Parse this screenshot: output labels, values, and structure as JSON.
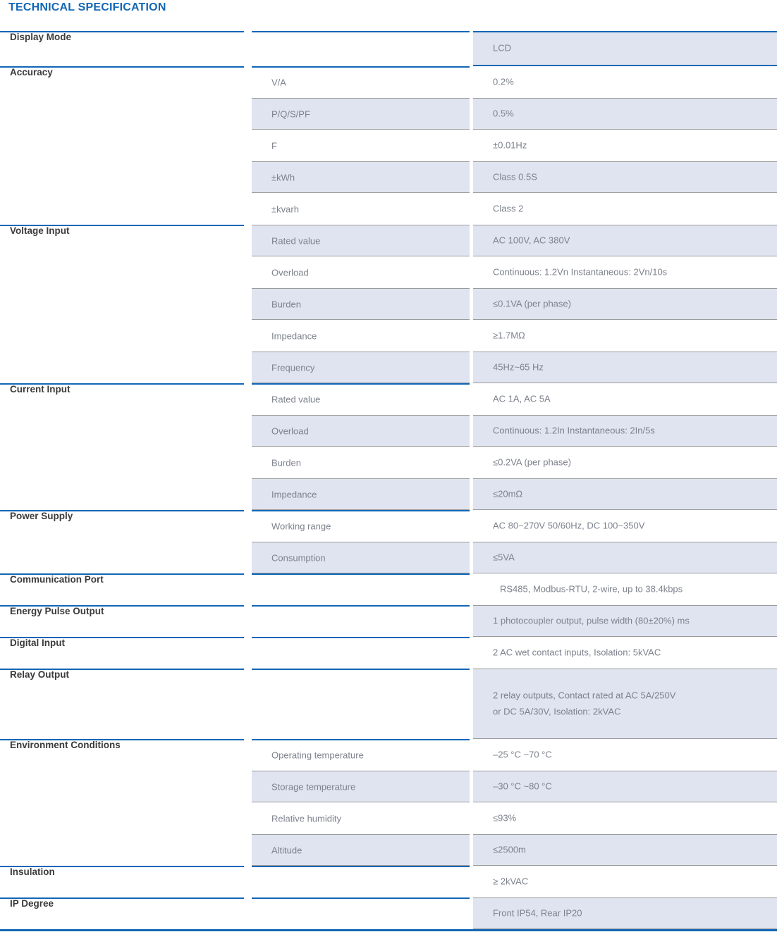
{
  "title": "TECHNICAL SPECIFICATION",
  "colors": {
    "accent_blue": "#1267B5",
    "row_shade": "#DFE4F0",
    "rule_gray": "#9A9A9A",
    "label_text": "#3B3B3B",
    "value_text": "#7D828C"
  },
  "groups": [
    {
      "label": "Display Mode",
      "rows": [
        {
          "param": "",
          "value": "LCD",
          "shaded": true
        }
      ]
    },
    {
      "label": "Accuracy",
      "rows": [
        {
          "param": "V/A",
          "value": "0.2%",
          "shaded": false
        },
        {
          "param": "P/Q/S/PF",
          "value": "0.5%",
          "shaded": true
        },
        {
          "param": "F",
          "value": "±0.01Hz",
          "shaded": false
        },
        {
          "param": "±kWh",
          "value": "Class 0.5S",
          "shaded": true
        },
        {
          "param": "±kvarh",
          "value": "Class 2",
          "shaded": false
        }
      ]
    },
    {
      "label": "Voltage Input",
      "rows": [
        {
          "param": "Rated value",
          "value": "AC 100V, AC 380V",
          "shaded": true
        },
        {
          "param": "Overload",
          "value": "Continuous: 1.2Vn  Instantaneous: 2Vn/10s",
          "shaded": false
        },
        {
          "param": "Burden",
          "value": "≤0.1VA (per phase)",
          "shaded": true
        },
        {
          "param": "Impedance",
          "value": "≥1.7MΩ",
          "shaded": false
        },
        {
          "param": "Frequency",
          "value": "45Hz~65 Hz",
          "shaded": true
        }
      ]
    },
    {
      "label": "Current Input",
      "rows": [
        {
          "param": "Rated value",
          "value": "AC 1A, AC 5A",
          "shaded": false
        },
        {
          "param": "Overload",
          "value": "Continuous: 1.2In  Instantaneous: 2In/5s",
          "shaded": true
        },
        {
          "param": "Burden",
          "value": "≤0.2VA (per phase)",
          "shaded": false
        },
        {
          "param": "Impedance",
          "value": "≤20mΩ",
          "shaded": true
        }
      ]
    },
    {
      "label": "Power Supply",
      "rows": [
        {
          "param": "Working range",
          "value": "AC 80~270V 50/60Hz, DC 100~350V",
          "shaded": false
        },
        {
          "param": "Consumption",
          "value": "≤5VA",
          "shaded": true
        }
      ]
    },
    {
      "label": "Communication Port",
      "rows": [
        {
          "param": "",
          "value": "RS485, Modbus-RTU, 2-wire, up to 38.4kbps",
          "shaded": false,
          "wide_indent": true
        }
      ]
    },
    {
      "label": "Energy Pulse Output",
      "rows": [
        {
          "param": "",
          "value": "1 photocoupler output, pulse width (80±20%) ms",
          "shaded": true
        }
      ]
    },
    {
      "label": "Digital Input",
      "rows": [
        {
          "param": "",
          "value": "2 AC wet contact inputs, Isolation: 5kVAC",
          "shaded": false
        }
      ]
    },
    {
      "label": "Relay Output",
      "rows": [
        {
          "param": "",
          "value": "2 relay outputs, Contact rated at AC 5A/250V\nor DC 5A/30V, Isolation: 2kVAC",
          "shaded": true,
          "tall": true
        }
      ]
    },
    {
      "label": "Environment Conditions",
      "rows": [
        {
          "param": "Operating temperature",
          "value": "–25 °C ~70 °C",
          "shaded": false
        },
        {
          "param": "Storage temperature",
          "value": "–30 °C ~80 °C",
          "shaded": true
        },
        {
          "param": "Relative humidity",
          "value": "≤93%",
          "shaded": false
        },
        {
          "param": "Altitude",
          "value": "≤2500m",
          "shaded": true
        }
      ]
    },
    {
      "label": "Insulation",
      "rows": [
        {
          "param": "",
          "value": "≥ 2kVAC",
          "shaded": false
        }
      ]
    },
    {
      "label": "IP Degree",
      "rows": [
        {
          "param": "",
          "value": "Front IP54, Rear IP20",
          "shaded": true
        }
      ]
    }
  ]
}
